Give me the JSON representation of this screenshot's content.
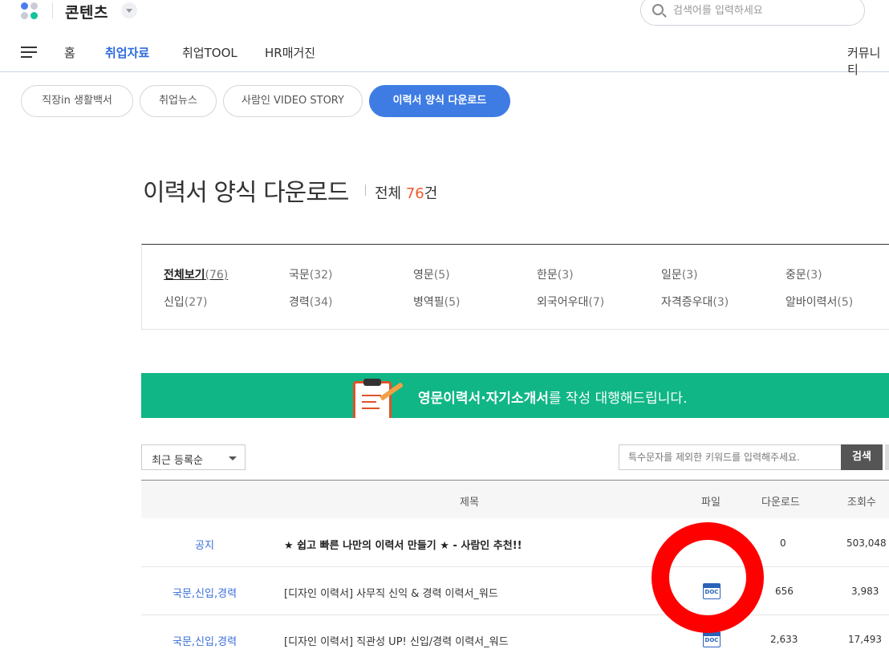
{
  "header": {
    "brand": "콘텐츠",
    "search_placeholder": "검색어를 입력하세요",
    "logo_colors": [
      "#4a7df0",
      "#c9cbd6",
      "#12c39b",
      "#4a7df0"
    ]
  },
  "nav": {
    "items": [
      "홈",
      "취업자료",
      "취업TOOL",
      "HR매거진"
    ],
    "active_index": 1,
    "right_item": "커뮤니티"
  },
  "tabs": {
    "items": [
      "직장in 생활백서",
      "취업뉴스",
      "사람인 VIDEO STORY",
      "이력서 양식 다운로드"
    ],
    "active_index": 3
  },
  "page": {
    "title": "이력서 양식 다운로드",
    "total_prefix": "전체",
    "total_count": "76",
    "total_suffix": "건"
  },
  "categories": [
    {
      "label": "전체보기",
      "count": "(76)",
      "active": true
    },
    {
      "label": "국문",
      "count": "(32)"
    },
    {
      "label": "영문",
      "count": "(5)"
    },
    {
      "label": "한문",
      "count": "(3)"
    },
    {
      "label": "일문",
      "count": "(3)"
    },
    {
      "label": "중문",
      "count": "(3)"
    },
    {
      "label": "신입",
      "count": "(27)"
    },
    {
      "label": "경력",
      "count": "(34)"
    },
    {
      "label": "병역필",
      "count": "(5)"
    },
    {
      "label": "외국어우대",
      "count": "(7)"
    },
    {
      "label": "자격증우대",
      "count": "(3)"
    },
    {
      "label": "알바이력서",
      "count": "(5)"
    }
  ],
  "banner": {
    "bold_text": "영문이력서·자기소개서",
    "rest_text": "를 작성 대행해드립니다.",
    "color": "#10b686"
  },
  "controls": {
    "sort_label": "최근 등록순",
    "keyword_placeholder": "특수문자를 제외한 키워드를 입력해주세요.",
    "search_button": "검색"
  },
  "table": {
    "headers": {
      "title": "제목",
      "file": "파일",
      "downloads": "다운로드",
      "views": "조회수"
    },
    "rows": [
      {
        "category": "공지",
        "title": "★ 쉽고 빠른 나만의 이력서 만들기 ★ - 사람인 추천!!",
        "file": "",
        "downloads": "0",
        "views": "503,048"
      },
      {
        "category": "국문,신입,경력",
        "title": "[디자인 이력서] 사무직 신익 & 경력 이력서_워드",
        "file": "DOC",
        "downloads": "656",
        "views": "3,983"
      },
      {
        "category": "국문,신입,경력",
        "title": "[디자인 이력서] 직관성 UP! 신입/경력 이력서_워드",
        "file": "DOC",
        "downloads": "2,633",
        "views": "17,493"
      }
    ]
  }
}
